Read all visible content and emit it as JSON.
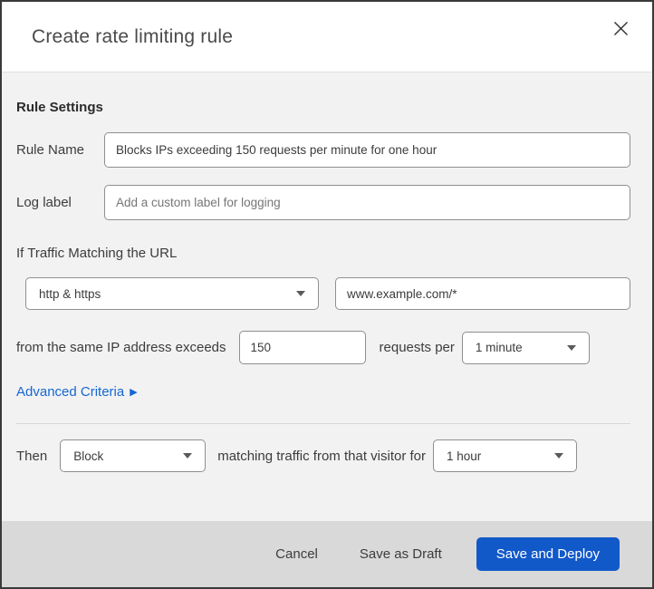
{
  "modal": {
    "title": "Create rate limiting rule"
  },
  "form": {
    "section_heading": "Rule Settings",
    "rule_name": {
      "label": "Rule Name",
      "value": "Blocks IPs exceeding 150 requests per minute for one hour"
    },
    "log_label": {
      "label": "Log label",
      "placeholder": "Add a custom label for logging"
    },
    "traffic_match": {
      "intro": "If Traffic Matching the URL",
      "scheme_selected": "http & https",
      "url_value": "www.example.com/*"
    },
    "threshold": {
      "prefix": "from the same IP address exceeds",
      "requests_value": "150",
      "middle": "requests per",
      "period_selected": "1 minute"
    },
    "advanced_link": {
      "label": "Advanced Criteria",
      "arrow": "▶"
    },
    "action": {
      "prefix": "Then",
      "action_selected": "Block",
      "middle": "matching traffic from that visitor for",
      "duration_selected": "1 hour"
    }
  },
  "footer": {
    "cancel_label": "Cancel",
    "save_draft_label": "Save as Draft",
    "save_deploy_label": "Save and Deploy"
  },
  "colors": {
    "accent_strip": "#0c2233",
    "link_blue": "#1567d3",
    "primary_button": "#1159c9",
    "body_background": "#f2f2f2",
    "footer_background": "#d9d9d9"
  }
}
